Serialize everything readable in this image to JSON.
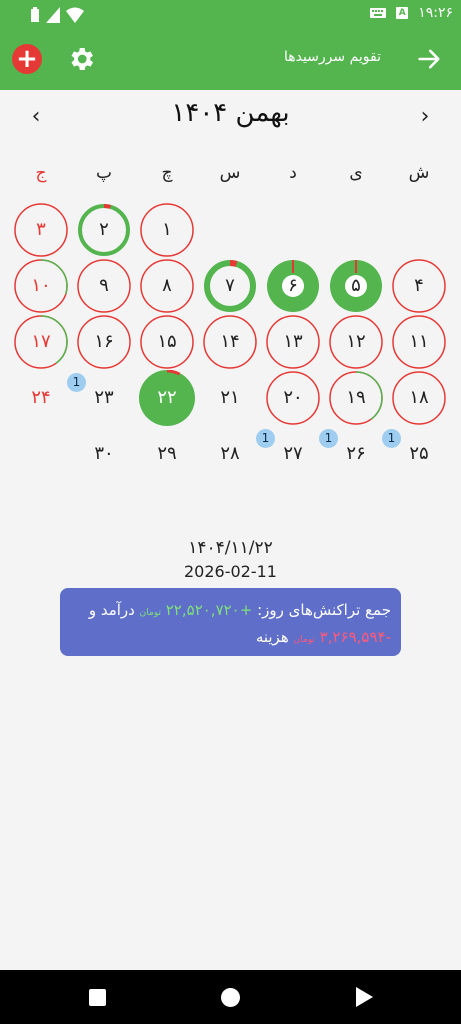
{
  "status": {
    "time": "۱۹:۲۶",
    "notif_letter": "A"
  },
  "appbar": {
    "title": "تقویم سررسیدها",
    "add_label": "+"
  },
  "nav": {
    "prev": "‹",
    "next": "›"
  },
  "month": {
    "title": "بهمن ۱۴۰۴"
  },
  "weekdays": [
    "ش",
    "ی",
    "د",
    "س",
    "چ",
    "پ",
    "ج"
  ],
  "days": [
    {
      "label": "۱",
      "col": 4,
      "row": 0,
      "style": "red"
    },
    {
      "label": "۲",
      "col": 5,
      "row": 0,
      "style": "green-ring"
    },
    {
      "label": "۳",
      "col": 6,
      "row": 0,
      "style": "red",
      "text": "red"
    },
    {
      "label": "۴",
      "col": 0,
      "row": 1,
      "style": "red"
    },
    {
      "label": "۵",
      "col": 1,
      "row": 1,
      "style": "donut"
    },
    {
      "label": "۶",
      "col": 2,
      "row": 1,
      "style": "donut"
    },
    {
      "label": "۷",
      "col": 3,
      "row": 1,
      "style": "thick-green"
    },
    {
      "label": "۸",
      "col": 4,
      "row": 1,
      "style": "red"
    },
    {
      "label": "۹",
      "col": 5,
      "row": 1,
      "style": "red"
    },
    {
      "label": "۱۰",
      "col": 6,
      "row": 1,
      "style": "mixed",
      "text": "red"
    },
    {
      "label": "۱۱",
      "col": 0,
      "row": 2,
      "style": "red"
    },
    {
      "label": "۱۲",
      "col": 1,
      "row": 2,
      "style": "red"
    },
    {
      "label": "۱۳",
      "col": 2,
      "row": 2,
      "style": "red"
    },
    {
      "label": "۱۴",
      "col": 3,
      "row": 2,
      "style": "red"
    },
    {
      "label": "۱۵",
      "col": 4,
      "row": 2,
      "style": "red"
    },
    {
      "label": "۱۶",
      "col": 5,
      "row": 2,
      "style": "red"
    },
    {
      "label": "۱۷",
      "col": 6,
      "row": 2,
      "style": "mixed-green",
      "text": "red"
    },
    {
      "label": "۱۸",
      "col": 0,
      "row": 3,
      "style": "red"
    },
    {
      "label": "۱۹",
      "col": 1,
      "row": 3,
      "style": "mixed-green"
    },
    {
      "label": "۲۰",
      "col": 2,
      "row": 3,
      "style": "red"
    },
    {
      "label": "۲۱",
      "col": 3,
      "row": 3,
      "style": "none"
    },
    {
      "label": "۲۲",
      "col": 4,
      "row": 3,
      "style": "selected",
      "text": "white"
    },
    {
      "label": "۲۳",
      "col": 5,
      "row": 3,
      "style": "none",
      "badge": "1"
    },
    {
      "label": "۲۴",
      "col": 6,
      "row": 3,
      "style": "none",
      "text": "red"
    },
    {
      "label": "۲۵",
      "col": 0,
      "row": 4,
      "style": "none",
      "badge": "1"
    },
    {
      "label": "۲۶",
      "col": 1,
      "row": 4,
      "style": "none",
      "badge": "1"
    },
    {
      "label": "۲۷",
      "col": 2,
      "row": 4,
      "style": "none",
      "badge": "1"
    },
    {
      "label": "۲۸",
      "col": 3,
      "row": 4,
      "style": "none"
    },
    {
      "label": "۲۹",
      "col": 4,
      "row": 4,
      "style": "none"
    },
    {
      "label": "۳۰",
      "col": 5,
      "row": 4,
      "style": "none"
    }
  ],
  "selected": {
    "date_fa": "۱۴۰۴/۱۱/۲۲",
    "date_en": "2026-02-11"
  },
  "summary": {
    "prefix": "جمع تراکنش‌های روز:",
    "income": "+۲۲,۵۲۰,۷۲۰",
    "income_unit": "تومان",
    "income_label": "درآمد و",
    "expense": "-۳,۲۶۹,۵۹۴",
    "expense_unit": "تومان",
    "expense_label": "هزینه"
  },
  "colors": {
    "green": "#54b54f",
    "red": "#e53935",
    "badge": "#9fcdf0",
    "card": "#5f6ec8"
  }
}
